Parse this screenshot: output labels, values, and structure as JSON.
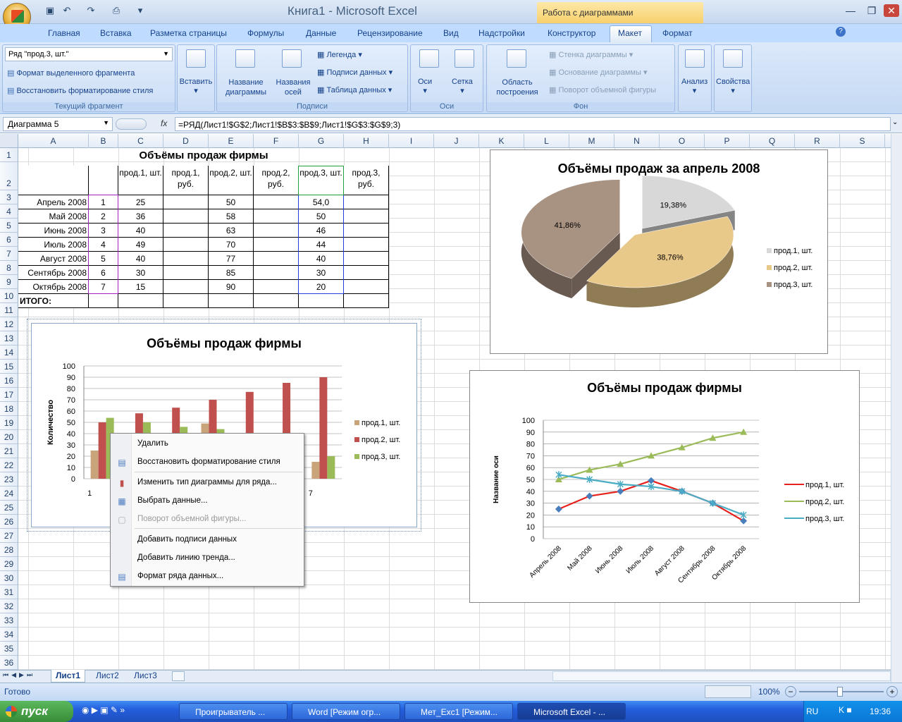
{
  "window": {
    "title": "Книга1 - Microsoft Excel",
    "context_tools": "Работа с диаграммами"
  },
  "tabs": [
    "Главная",
    "Вставка",
    "Разметка страницы",
    "Формулы",
    "Данные",
    "Рецензирование",
    "Вид",
    "Надстройки",
    "Конструктор",
    "Макет",
    "Формат"
  ],
  "ribbon": {
    "current": {
      "selector": "Ряд \"прод.3, шт.\"",
      "format_selection": "Формат выделенного фрагмента",
      "reset_style": "Восстановить форматирование стиля",
      "label": "Текущий фрагмент"
    },
    "insert": "Вставить",
    "labels": {
      "chart_title": "Название диаграммы",
      "axis_titles": "Названия осей",
      "legend": "Легенда",
      "data_labels": "Подписи данных",
      "data_table": "Таблица данных",
      "label": "Подписи"
    },
    "axes": {
      "axes": "Оси",
      "grid": "Сетка",
      "label": "Оси"
    },
    "background": {
      "plot_area": "Область построения",
      "wall": "Стенка диаграммы",
      "floor": "Основание диаграммы",
      "rotation": "Поворот объемной фигуры",
      "label": "Фон"
    },
    "analysis": "Анализ",
    "properties": "Свойства"
  },
  "formula_bar": {
    "name_box": "Диаграмма 5",
    "fx": "fx",
    "formula": "=РЯД(Лист1!$G$2;Лист1!$B$3:$B$9;Лист1!$G$3:$G$9;3)"
  },
  "columns": [
    "A",
    "B",
    "C",
    "D",
    "E",
    "F",
    "G",
    "H",
    "I",
    "J",
    "K",
    "L",
    "M",
    "N",
    "O",
    "P",
    "Q",
    "R",
    "S"
  ],
  "rows": [
    "1",
    "2",
    "3",
    "4",
    "5",
    "6",
    "7",
    "8",
    "9",
    "10",
    "11",
    "12",
    "13",
    "14",
    "15",
    "16",
    "17",
    "18",
    "19",
    "20",
    "21",
    "22",
    "23",
    "24",
    "25",
    "26",
    "27",
    "28",
    "29",
    "30",
    "31",
    "32",
    "33",
    "34",
    "35",
    "36"
  ],
  "table": {
    "title": "Объёмы продаж фирмы",
    "headers": [
      "прод.1, шт.",
      "прод.1, руб.",
      "прод.2, шт.",
      "прод.2, руб.",
      "прод.3, шт.",
      "прод.3, руб."
    ],
    "rows": [
      {
        "month": "Апрель 2008",
        "n": "1",
        "p1": "25",
        "p2": "50",
        "p3": "54,0"
      },
      {
        "month": "Май 2008",
        "n": "2",
        "p1": "36",
        "p2": "58",
        "p3": "50"
      },
      {
        "month": "Июнь 2008",
        "n": "3",
        "p1": "40",
        "p2": "63",
        "p3": "46"
      },
      {
        "month": "Июль 2008",
        "n": "4",
        "p1": "49",
        "p2": "70",
        "p3": "44"
      },
      {
        "month": "Август 2008",
        "n": "5",
        "p1": "40",
        "p2": "77",
        "p3": "40"
      },
      {
        "month": "Сентябрь 2008",
        "n": "6",
        "p1": "30",
        "p2": "85",
        "p3": "30"
      },
      {
        "month": "Октябрь 2008",
        "n": "7",
        "p1": "15",
        "p2": "90",
        "p3": "20"
      }
    ],
    "total": "ИТОГО:"
  },
  "chart_data": [
    {
      "type": "bar",
      "title": "Объёмы продаж фирмы",
      "ylabel": "Количество",
      "categories": [
        "1",
        "2",
        "3",
        "4",
        "5",
        "6",
        "7"
      ],
      "ylim": [
        0,
        100
      ],
      "yticks": [
        "0",
        "10",
        "20",
        "30",
        "40",
        "50",
        "60",
        "70",
        "80",
        "90",
        "100"
      ],
      "series": [
        {
          "name": "прод.1, шт.",
          "values": [
            25,
            36,
            40,
            49,
            40,
            30,
            15
          ],
          "color": "#c9a37a"
        },
        {
          "name": "прод.2, шт.",
          "values": [
            50,
            58,
            63,
            70,
            77,
            85,
            90
          ],
          "color": "#c0504d"
        },
        {
          "name": "прод.3, шт.",
          "values": [
            54,
            50,
            46,
            44,
            40,
            30,
            20
          ],
          "color": "#9bbb59"
        }
      ],
      "legend": "right",
      "grid": true
    },
    {
      "type": "pie",
      "title": "Объёмы продаж за апрель 2008",
      "slices": [
        {
          "name": "прод.1, шт.",
          "pct": "19,38%",
          "value": 19.38,
          "color": "#d8d8d8"
        },
        {
          "name": "прод.2, шт.",
          "pct": "38,76%",
          "value": 38.76,
          "color": "#e8c98a"
        },
        {
          "name": "прод.3, шт.",
          "pct": "41,86%",
          "value": 41.86,
          "color": "#a89282"
        }
      ],
      "legend": "right"
    },
    {
      "type": "line",
      "title": "Объёмы продаж фирмы",
      "ylabel": "Название оси",
      "categories": [
        "Апрель 2008",
        "Май 2008",
        "Июнь 2008",
        "Июль 2008",
        "Август 2008",
        "Сентябрь 2008",
        "Октябрь 2008"
      ],
      "ylim": [
        0,
        100
      ],
      "yticks": [
        "0",
        "10",
        "20",
        "30",
        "40",
        "50",
        "60",
        "70",
        "80",
        "90",
        "100"
      ],
      "series": [
        {
          "name": "прод.1, шт.",
          "values": [
            25,
            36,
            40,
            49,
            40,
            30,
            15
          ],
          "color": "#e8201c",
          "marker": "#4a7ebb"
        },
        {
          "name": "прод.2, шт.",
          "values": [
            50,
            58,
            63,
            70,
            77,
            85,
            90
          ],
          "color": "#9bbb59",
          "marker": "#9bbb59"
        },
        {
          "name": "прод.3, шт.",
          "values": [
            54,
            50,
            46,
            44,
            40,
            30,
            20
          ],
          "color": "#4bacc6",
          "marker": "#4bacc6"
        }
      ],
      "legend": "right",
      "grid": true
    }
  ],
  "context_menu": [
    "Удалить",
    "Восстановить форматирование стиля",
    "Изменить тип диаграммы для ряда...",
    "Выбрать данные...",
    "Поворот объемной фигуры...",
    "Добавить подписи данных",
    "Добавить линию тренда...",
    "Формат ряда данных..."
  ],
  "sheets": [
    "Лист1",
    "Лист2",
    "Лист3"
  ],
  "status": {
    "ready": "Готово",
    "zoom": "100%"
  },
  "taskbar": {
    "start": "пуск",
    "tasks": [
      "Проигрыватель ...",
      "Word [Режим огр...",
      "Мет_Exc1 [Режим...",
      "Microsoft Excel - ..."
    ],
    "lang": "RU",
    "time": "19:36"
  }
}
